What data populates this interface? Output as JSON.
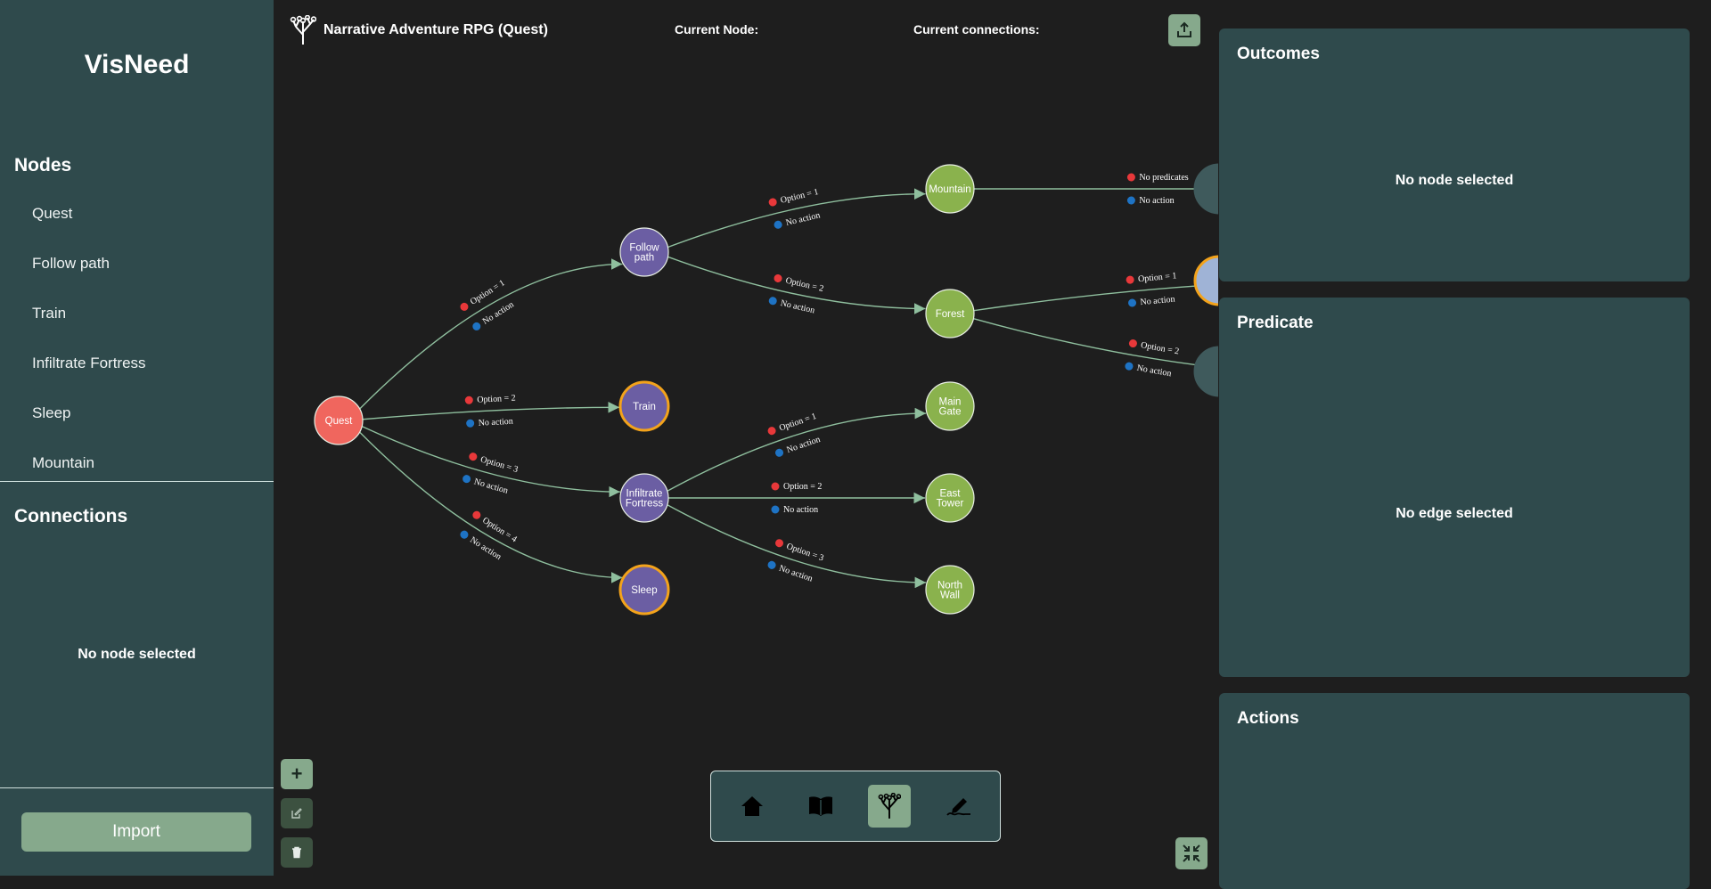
{
  "sidebar": {
    "app_title": "VisNeed",
    "nodes_heading": "Nodes",
    "nodes": [
      "Quest",
      "Follow path",
      "Train",
      "Infiltrate Fortress",
      "Sleep",
      "Mountain"
    ],
    "connections_heading": "Connections",
    "connections_empty": "No node selected",
    "import_label": "Import"
  },
  "topbar": {
    "project_title": "Narrative Adventure RPG (Quest)",
    "current_node_label": "Current Node:",
    "current_connections_label": "Current connections:"
  },
  "panels": {
    "outcomes_title": "Outcomes",
    "outcomes_empty": "No node selected",
    "predicate_title": "Predicate",
    "predicate_empty": "No edge selected",
    "actions_title": "Actions"
  },
  "tools": {
    "add_label": "+",
    "nav_icons": [
      "home-icon",
      "book-icon",
      "tree-icon",
      "signature-icon"
    ],
    "active_nav": "tree-icon"
  },
  "colors": {
    "root_node": "#f0665e",
    "branch_node": "#6b5ea3",
    "leaf_node": "#8ab24d",
    "highlight_ring": "#f3a31b",
    "edge": "#8fbf9e",
    "predicate_dot": "#e8383a",
    "action_dot": "#1e73c4"
  },
  "graph": {
    "nodes": [
      {
        "id": "quest",
        "label": "Quest",
        "kind": "root"
      },
      {
        "id": "follow",
        "label": "Follow\npath",
        "kind": "branch"
      },
      {
        "id": "train",
        "label": "Train",
        "kind": "highlight"
      },
      {
        "id": "infiltrate",
        "label": "Infiltrate\nFortress",
        "kind": "branch"
      },
      {
        "id": "sleep",
        "label": "Sleep",
        "kind": "highlight"
      },
      {
        "id": "mountain",
        "label": "Mountain",
        "kind": "leaf"
      },
      {
        "id": "forest",
        "label": "Forest",
        "kind": "leaf"
      },
      {
        "id": "maingate",
        "label": "Main\nGate",
        "kind": "leaf"
      },
      {
        "id": "easttower",
        "label": "East\nTower",
        "kind": "leaf"
      },
      {
        "id": "northwall",
        "label": "North\nWall",
        "kind": "leaf"
      }
    ],
    "edges": [
      {
        "from": "quest",
        "to": "follow",
        "predicate": "Option = 1",
        "action": "No action"
      },
      {
        "from": "quest",
        "to": "train",
        "predicate": "Option = 2",
        "action": "No action"
      },
      {
        "from": "quest",
        "to": "infiltrate",
        "predicate": "Option = 3",
        "action": "No action"
      },
      {
        "from": "quest",
        "to": "sleep",
        "predicate": "Option = 4",
        "action": "No action"
      },
      {
        "from": "follow",
        "to": "mountain",
        "predicate": "Option = 1",
        "action": "No action"
      },
      {
        "from": "follow",
        "to": "forest",
        "predicate": "Option = 2",
        "action": "No action"
      },
      {
        "from": "infiltrate",
        "to": "maingate",
        "predicate": "Option = 1",
        "action": "No action"
      },
      {
        "from": "infiltrate",
        "to": "easttower",
        "predicate": "Option = 2",
        "action": "No action"
      },
      {
        "from": "infiltrate",
        "to": "northwall",
        "predicate": "Option = 3",
        "action": "No action"
      },
      {
        "from": "mountain",
        "to": "offscreen-a",
        "predicate": "No predicates",
        "action": "No action"
      },
      {
        "from": "forest",
        "to": "offscreen-b",
        "predicate": "Option = 1",
        "action": "No action"
      },
      {
        "from": "forest",
        "to": "offscreen-c",
        "predicate": "Option = 2",
        "action": "No action"
      }
    ]
  }
}
